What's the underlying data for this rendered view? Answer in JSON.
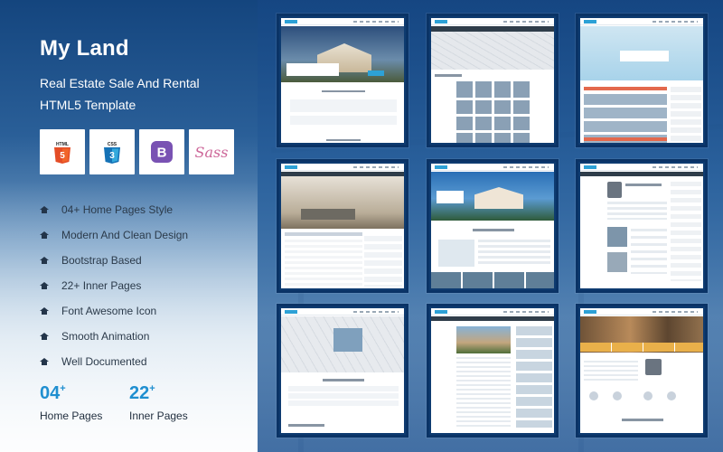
{
  "brand": {
    "title": "My Land",
    "subtitle": "Real Estate Sale And Rental HTML5 Template"
  },
  "tech_badges": [
    {
      "name": "html5-icon",
      "label": "HTML",
      "color": "#e44d26"
    },
    {
      "name": "css3-icon",
      "label": "CSS",
      "color": "#1572b6"
    },
    {
      "name": "bootstrap-icon",
      "label": "B",
      "color": "#7952b3"
    },
    {
      "name": "sass-icon",
      "label": "Sass",
      "color": "#cd6799"
    }
  ],
  "features": [
    "04+ Home Pages Style",
    "Modern And Clean Design",
    "Bootstrap Based",
    "22+ Inner Pages",
    "Font Awesome Icon",
    "Smooth Animation",
    "Well Documented"
  ],
  "stats": [
    {
      "number": "04",
      "plus": "+",
      "label": "Home Pages"
    },
    {
      "number": "22",
      "plus": "+",
      "label": "Inner Pages"
    }
  ],
  "colors": {
    "accent": "#1f8fd0",
    "dark_navy": "#0e3b70",
    "feature_text": "#2b3a4a"
  },
  "previews": [
    {
      "name": "preview-home-1"
    },
    {
      "name": "preview-map-listing"
    },
    {
      "name": "preview-home-interior"
    },
    {
      "name": "preview-property-gallery"
    },
    {
      "name": "preview-home-2"
    },
    {
      "name": "preview-agent-profile"
    },
    {
      "name": "preview-map-search"
    },
    {
      "name": "preview-blog"
    },
    {
      "name": "preview-home-3"
    }
  ]
}
